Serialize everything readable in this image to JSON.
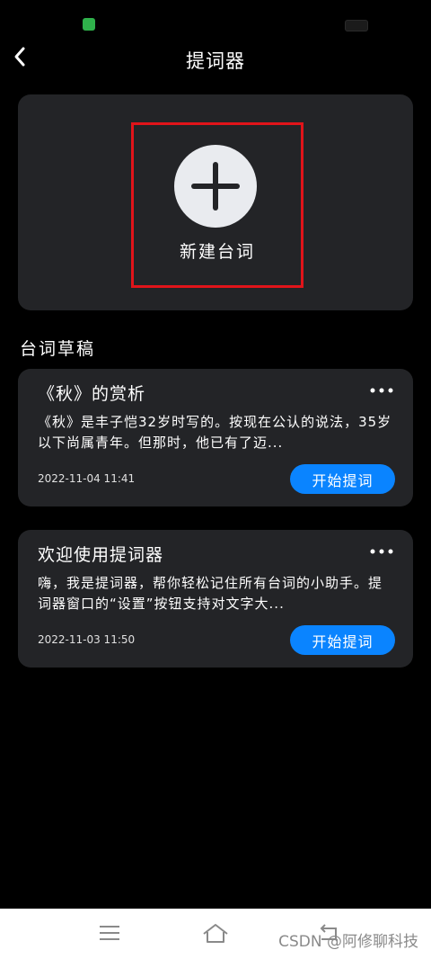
{
  "header": {
    "title": "提词器"
  },
  "new_card": {
    "label": "新建台词"
  },
  "section": {
    "title": "台词草稿"
  },
  "drafts": [
    {
      "title": "《秋》的赏析",
      "excerpt": "《秋》是丰子恺32岁时写的。按现在公认的说法，35岁以下尚属青年。但那时，他已有了迈...",
      "time": "2022-11-04 11:41",
      "action": "开始提词"
    },
    {
      "title": "欢迎使用提词器",
      "excerpt": "嗨，我是提词器，帮你轻松记住所有台词的小助手。提词器窗口的“设置”按钮支持对文字大...",
      "time": "2022-11-03 11:50",
      "action": "开始提词"
    }
  ],
  "watermark": "CSDN @阿修聊科技",
  "colors": {
    "background": "#000000",
    "card": "#232427",
    "accent": "#0a84ff",
    "highlight": "#e0141a"
  },
  "icons": {
    "back": "back-arrow-icon",
    "add": "plus-icon",
    "more": "more-dots-icon",
    "nav_menu": "menu-icon",
    "nav_home": "home-icon",
    "nav_back": "return-icon"
  }
}
